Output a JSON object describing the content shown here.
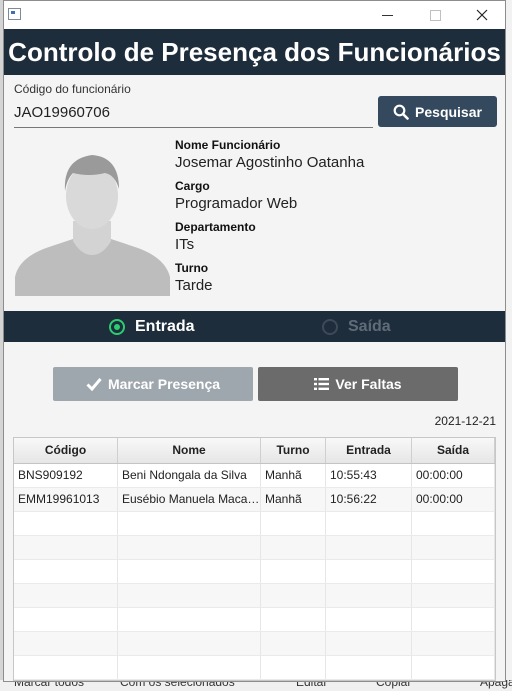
{
  "window": {
    "title": ""
  },
  "background": {
    "bottom_items": [
      "Marcar todos",
      "Com os selecionados",
      "Editar",
      "Copiar",
      "Apagar"
    ]
  },
  "header": {
    "title": "Controlo de Presença dos Funcionários"
  },
  "search": {
    "label": "Código do funcionário",
    "value": "JAO19960706",
    "button_label": "Pesquisar",
    "button_icon": "search-icon"
  },
  "employee": {
    "name_label": "Nome Funcionário",
    "name": "Josemar Agostinho Oatanha",
    "cargo_label": "Cargo",
    "cargo": "Programador Web",
    "department_label": "Departamento",
    "department": "ITs",
    "shift_label": "Turno",
    "shift": "Tarde"
  },
  "mode": {
    "entrada_label": "Entrada",
    "saida_label": "Saída",
    "selected": "Entrada"
  },
  "actions": {
    "mark_label": "Marcar Presença",
    "mark_icon": "check-icon",
    "absences_label": "Ver Faltas",
    "absences_icon": "list-icon"
  },
  "date": "2021-12-21",
  "table": {
    "columns": [
      "Código",
      "Nome",
      "Turno",
      "Entrada",
      "Saída"
    ],
    "rows": [
      [
        "BNS909192",
        "Beni Ndongala da Silva",
        "Manhã",
        "10:55:43",
        "00:00:00"
      ],
      [
        "EMM19961013",
        "Eusébio Manuela Macaco",
        "Manhã",
        "10:56:22",
        "00:00:00"
      ]
    ],
    "empty_rows": 7
  },
  "colors": {
    "header_bg": "#1e2d3b",
    "search_button": "#34495e",
    "radio_active": "#2ecc71",
    "mark_button": "#9fa7ae",
    "absences_button": "#6b6b6b"
  }
}
